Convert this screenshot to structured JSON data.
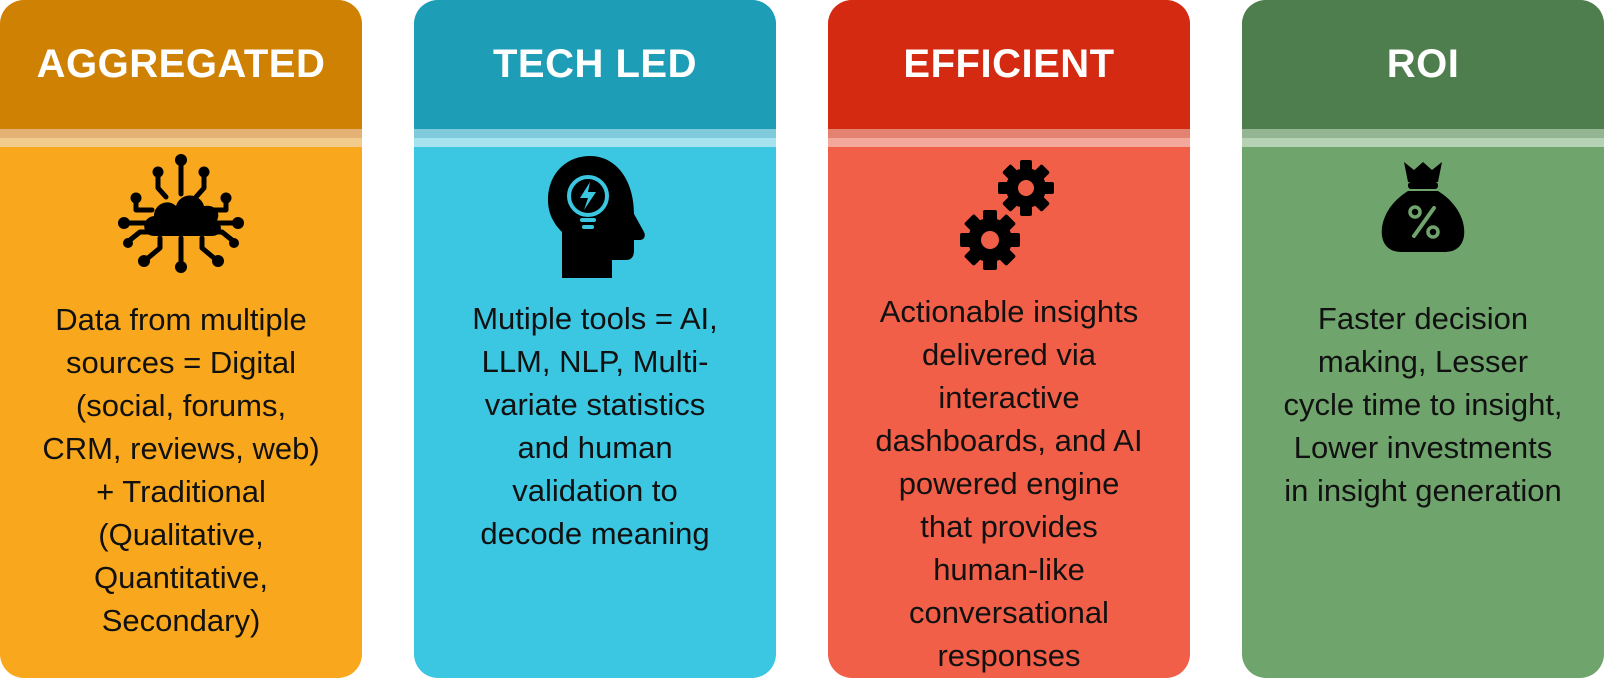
{
  "cards": [
    {
      "title": "AGGREGATED",
      "icon": "cloud-network-icon",
      "lines": [
        "Data from multiple",
        "sources = Digital",
        "(social, forums,",
        "CRM, reviews, web)",
        "+ Traditional",
        "(Qualitative,",
        "Quantitative,",
        "Secondary)"
      ]
    },
    {
      "title": "TECH LED",
      "icon": "head-lightbulb-icon",
      "lines": [
        "Mutiple tools = AI,",
        "LLM, NLP, Multi-",
        "variate statistics",
        "and human",
        "validation to",
        "decode meaning"
      ]
    },
    {
      "title": "EFFICIENT",
      "icon": "gears-icon",
      "lines": [
        "Actionable insights",
        "delivered via",
        "interactive",
        "dashboards, and AI",
        "powered engine",
        "that provides",
        "human-like",
        "conversational",
        "responses"
      ]
    },
    {
      "title": "ROI",
      "icon": "money-bag-percent-icon",
      "lines": [
        "Faster decision",
        "making, Lesser",
        "cycle time to insight,",
        "Lower investments",
        "in insight generation"
      ]
    }
  ],
  "colors": {
    "aggregated": "#F9A81D",
    "tech_led": "#3BC6E1",
    "efficient": "#F15F48",
    "roi": "#6FA56C"
  }
}
